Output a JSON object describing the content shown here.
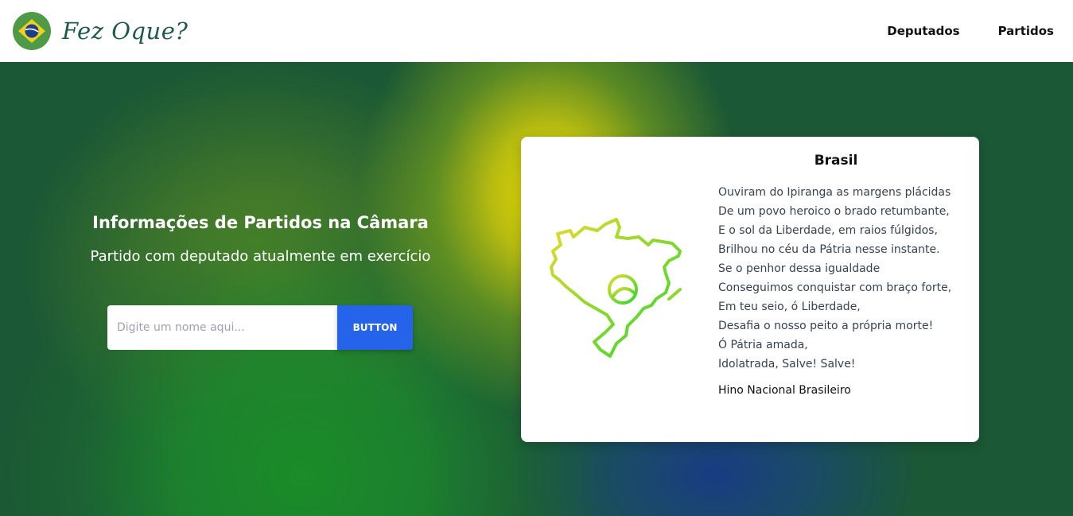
{
  "navbar": {
    "brand_name": "Fez Oque?",
    "logo_icon": "brazil-flag-icon",
    "links": [
      {
        "label": "Deputados"
      },
      {
        "label": "Partidos"
      }
    ]
  },
  "hero": {
    "title": "Informações de Partidos na Câmara",
    "subtitle": "Partido com deputado atualmente em exercício",
    "search": {
      "placeholder": "Digite um nome aqui...",
      "value": "",
      "button_label": "BUTTON"
    }
  },
  "card": {
    "title": "Brasil",
    "map_icon": "brazil-map-icon",
    "poem_lines": [
      "Ouviram do Ipiranga as margens plácidas",
      "De um povo heroico o brado retumbante,",
      "E o sol da Liberdade, em raios fúlgidos,",
      "Brilhou no céu da Pátria nesse instante.",
      "Se o penhor dessa igualdade",
      "Conseguimos conquistar com braço forte,",
      "Em teu seio, ó Liberdade,",
      "Desafia o nosso peito a própria morte!",
      "Ó Pátria amada,",
      "Idolatrada, Salve! Salve!"
    ],
    "source": "Hino Nacional Brasileiro"
  },
  "colors": {
    "brand_text": "#1e5a4e",
    "button": "#2563eb",
    "hero_green": "#1b5835",
    "hero_yellow": "#e6da00",
    "hero_blue": "#193c82"
  }
}
